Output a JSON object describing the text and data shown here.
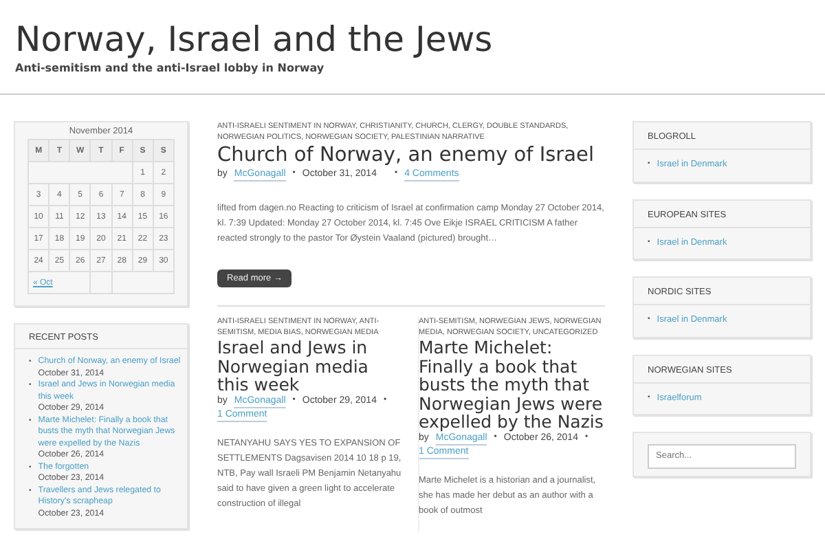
{
  "site": {
    "title": "Norway, Israel and the Jews",
    "tagline": "Anti-semitism and the anti-Israel lobby in Norway"
  },
  "calendar": {
    "caption": "November 2014",
    "weekdays": [
      "M",
      "T",
      "W",
      "T",
      "F",
      "S",
      "S"
    ],
    "weeks": [
      [
        "1",
        "2"
      ],
      [
        "3",
        "4",
        "5",
        "6",
        "7",
        "8",
        "9"
      ],
      [
        "10",
        "11",
        "12",
        "13",
        "14",
        "15",
        "16"
      ],
      [
        "17",
        "18",
        "19",
        "20",
        "21",
        "22",
        "23"
      ],
      [
        "24",
        "25",
        "26",
        "27",
        "28",
        "29",
        "30"
      ]
    ],
    "prev_link": "« Oct"
  },
  "recent_posts": {
    "title": "RECENT POSTS",
    "items": [
      {
        "bullet": "•",
        "link": "Church of Norway, an enemy of Israel",
        "date": "October 31, 2014"
      },
      {
        "bullet": "•",
        "link": "Israel and Jews in Norwegian media this week",
        "date": "October 29, 2014"
      },
      {
        "bullet": "•",
        "link": "Marte Michelet: Finally a book that busts the myth that Norwegian Jews were expelled by the Nazis",
        "date": "October 26, 2014"
      },
      {
        "bullet": "•",
        "link": "The forgotten",
        "date": "October 23, 2014"
      },
      {
        "bullet": "•",
        "link": "Travellers and Jews relegated to History's scrapheap",
        "date": "October 23, 2014"
      }
    ]
  },
  "posts": [
    {
      "categories": "ANTI-ISRAELI SENTIMENT IN NORWAY, CHRISTIANITY, CHURCH, CLERGY, DOUBLE STANDARDS, NORWEGIAN POLITICS, NORWEGIAN SOCIETY, PALESTINIAN NARRATIVE",
      "title": "Church of Norway, an enemy of Israel",
      "by": "by",
      "author": "McGonagall",
      "separators": [
        "•",
        "•"
      ],
      "date": "October 31, 2014",
      "comments": "4 Comments",
      "excerpt": "lifted from dagen.no Reacting to criticism of Israel at confirmation camp Monday 27 October 2014, kl. 7:39 Updated: Monday 27 October 2014, kl. 7:45 Ove Eikje ISRAEL CRITICISM A father reacted strongly to the pastor Tor Øystein Vaaland (pictured) brought…",
      "read_more": "Read more →"
    },
    {
      "categories": "ANTI-ISRAELI SENTIMENT IN NORWAY, ANTI-SEMITISM, MEDIA BIAS, NORWEGIAN MEDIA",
      "title": "Israel and Jews in Norwegian media this week",
      "by": "by",
      "author": "McGonagall",
      "separators": [
        "•",
        "•"
      ],
      "date": "October 29, 2014",
      "comments": "1 Comment",
      "excerpt": "NETANYAHU SAYS YES TO EXPANSION OF SETTLEMENTS Dagsavisen 2014 10 18 p 19, NTB, Pay wall  Israeli PM Benjamin Netanyahu said to have given a green light to accelerate construction of illegal"
    },
    {
      "categories": "ANTI-SEMITISM, NORWEGIAN JEWS, NORWEGIAN MEDIA, NORWEGIAN SOCIETY, UNCATEGORIZED",
      "title": "Marte Michelet: Finally a book that busts the myth that Norwegian Jews were expelled by the Nazis",
      "by": "by",
      "author": "McGonagall",
      "separators": [
        "•",
        "•"
      ],
      "date": "October 26, 2014",
      "comments": "1 Comment",
      "excerpt": "Marte Michelet is a historian and a journalist, she has made her debut as an author with a book of outmost"
    }
  ],
  "link_widgets": [
    {
      "title": "BLOGROLL",
      "links": [
        {
          "bullet": "•",
          "text": "Israel in Denmark"
        }
      ]
    },
    {
      "title": "EUROPEAN SITES",
      "links": [
        {
          "bullet": "•",
          "text": "Israel in Denmark"
        }
      ]
    },
    {
      "title": "NORDIC SITES",
      "links": [
        {
          "bullet": "•",
          "text": "Israel in Denmark"
        }
      ]
    },
    {
      "title": "NORWEGIAN SITES",
      "links": [
        {
          "bullet": "•",
          "text": "Israelforum"
        }
      ]
    }
  ],
  "search": {
    "placeholder": "Search..."
  }
}
